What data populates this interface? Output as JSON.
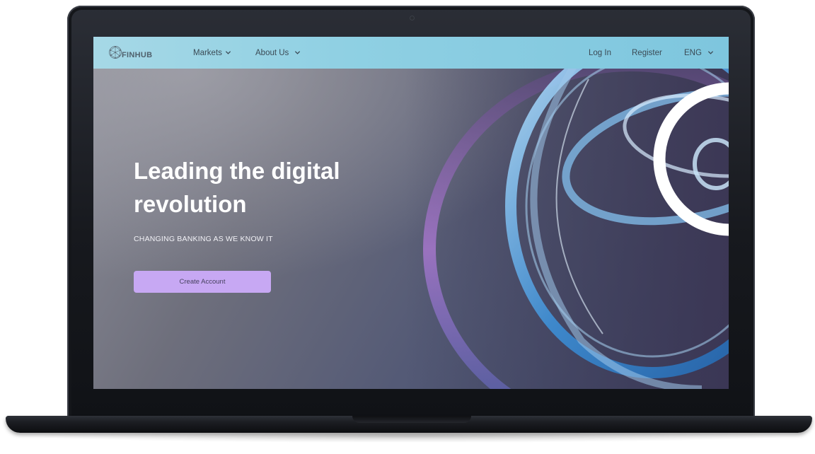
{
  "brand": {
    "name": "FINHUB",
    "logo_icon": "network-globe-icon"
  },
  "nav": {
    "left_items": [
      {
        "label": "Markets",
        "icon": "chevron-down-icon"
      },
      {
        "label": "About Us",
        "icon": "chevron-down-icon"
      }
    ],
    "login_label": "Log In",
    "register_label": "Register",
    "language": {
      "selected": "ENG",
      "icon": "chevron-down-icon"
    }
  },
  "hero": {
    "headline": "Leading the digital revolution",
    "subheading": "CHANGING BANKING AS WE KNOW IT",
    "cta_label": "Create Account",
    "art_icon": "abstract-rings-artwork"
  },
  "colors": {
    "nav_bg": "#8fd0e3",
    "cta_bg": "#c7a8f3",
    "headline": "#ffffff",
    "device_frame": "#1b1d22"
  }
}
